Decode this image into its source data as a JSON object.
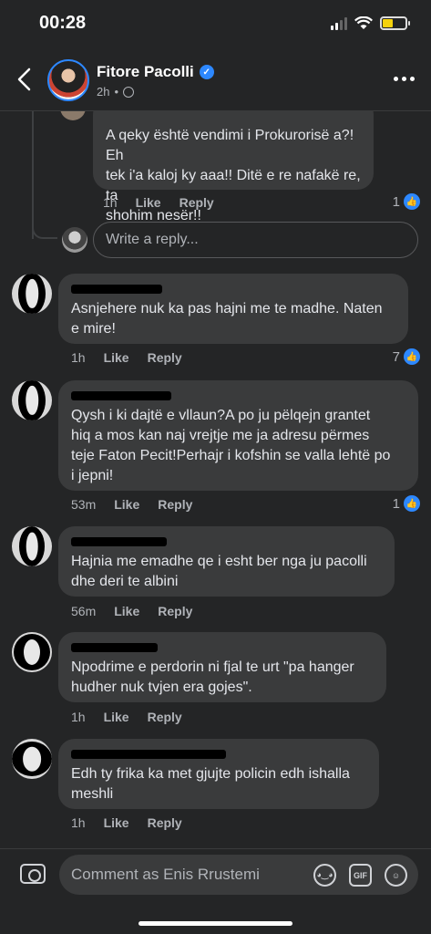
{
  "status": {
    "time": "00:28"
  },
  "header": {
    "page_name": "Fitore Pacolli",
    "age": "2h",
    "sep": "•"
  },
  "comments": [
    {
      "text": "A qeky është vendimi i Prokurorisë a?! Eh\ntek i'a kaloj ky aaa!! Ditë e re nafakë re, ta\nshohim nesër!!",
      "time": "1h",
      "like": "Like",
      "reply": "Reply",
      "reactions": "1"
    },
    {
      "text": "Asnjehere nuk ka pas hajni me te madhe. Naten\ne mire!",
      "time": "1h",
      "like": "Like",
      "reply": "Reply",
      "reactions": "7"
    },
    {
      "text": "Qysh i ki dajtë e vllaun?A po ju pëlqejn grantet\nhiq a mos kan naj vrejtje me ja adresu përmes\nteje Faton Pecit!Perhajr i kofshin se valla lehtë po\ni jepni!",
      "time": "53m",
      "like": "Like",
      "reply": "Reply",
      "reactions": "1"
    },
    {
      "text": "Hajnia me emadhe qe i esht ber nga ju pacolli\ndhe deri te albini",
      "time": "56m",
      "like": "Like",
      "reply": "Reply"
    },
    {
      "text": "Npodrime e perdorin ni fjal te urt \"pa hanger\nhudher nuk tvjen era gojes\".",
      "time": "1h",
      "like": "Like",
      "reply": "Reply"
    },
    {
      "text": "Edh ty frika ka met gjujte policin edh ishalla\nmeshli",
      "time": "1h",
      "like": "Like",
      "reply": "Reply"
    }
  ],
  "reply_box": {
    "placeholder": "Write a reply..."
  },
  "composer": {
    "placeholder": "Comment as Enis Rrustemi",
    "gif": "GIF"
  },
  "icons": [
    "back-icon",
    "verified-icon",
    "globe-icon",
    "more-icon",
    "like-icon",
    "camera-icon",
    "avatar-icon",
    "gif-icon",
    "emoji-icon"
  ],
  "colors": {
    "background": "#242526",
    "bubble": "#3a3b3c",
    "accent": "#2d88ff"
  }
}
